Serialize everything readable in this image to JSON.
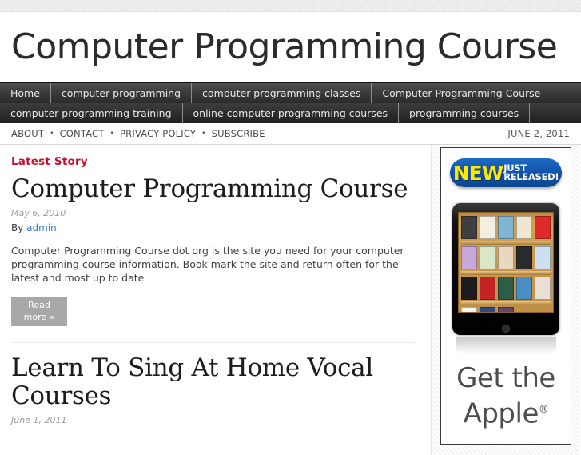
{
  "site": {
    "title": "Computer Programming Course"
  },
  "main_nav": {
    "row1": [
      {
        "label": "Home"
      },
      {
        "label": "computer programming"
      },
      {
        "label": "computer programming classes"
      },
      {
        "label": "Computer Programming Course"
      }
    ],
    "row2": [
      {
        "label": "computer programming training"
      },
      {
        "label": "online computer programming courses"
      },
      {
        "label": "programming courses"
      }
    ]
  },
  "meta_bar": {
    "links": [
      {
        "label": "ABOUT"
      },
      {
        "label": "CONTACT"
      },
      {
        "label": "PRIVACY POLICY"
      },
      {
        "label": "SUBSCRIBE"
      }
    ],
    "separator": "•",
    "date": "JUNE 2, 2011"
  },
  "main": {
    "kicker": "Latest Story",
    "posts": [
      {
        "title": "Computer Programming Course",
        "date": "May 6, 2010",
        "by_label": "By",
        "author": "admin",
        "excerpt": "Computer Programming Course dot org is the site you need for your computer programming course information. Book mark the site and return often for the latest and most up to date",
        "read_more_line1": "Read",
        "read_more_line2": "more »"
      },
      {
        "title": "Learn To Sing At Home Vocal Courses",
        "date": "June 1, 2011"
      }
    ]
  },
  "sidebar": {
    "ad": {
      "badge_new": "NEW",
      "badge_just": "JUST",
      "badge_released": "RELEASED!",
      "tagline_line1": "Get the",
      "tagline_line2": "Apple",
      "tagline_reg": "®",
      "shelf_rows": [
        [
          "#3f3f3f",
          "#f2efe2",
          "#7fb6d4",
          "#efe7cf",
          "#e02a2a"
        ],
        [
          "#c8a8d8",
          "#d9e6c8",
          "#e8d8c0",
          "#2a2a2a",
          "#cde0ef"
        ],
        [
          "#1c1c1c",
          "#c42424",
          "#2e5c48",
          "#4a8fc4",
          "#e8e0d8"
        ],
        [
          "#f6f4ef",
          "#2b4a8c",
          "#5a4a6e",
          "",
          ""
        ]
      ]
    }
  },
  "colors": {
    "accent_red": "#c8102e",
    "link_blue": "#3a7fc1",
    "nav_dark": "#2e2e2e",
    "readmore_gray": "#a8a8a8"
  }
}
